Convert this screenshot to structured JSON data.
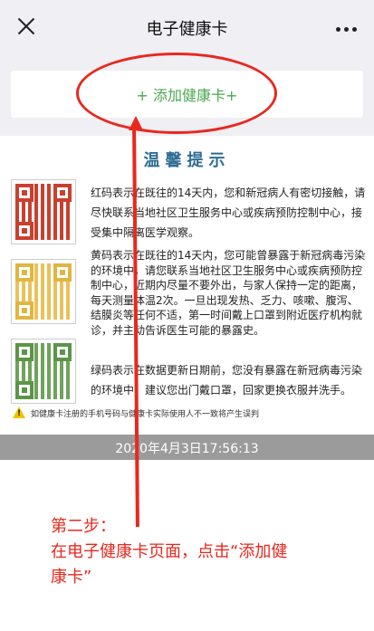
{
  "header": {
    "title": "电子健康卡",
    "close_icon": "close-icon",
    "more_icon": "more-icon"
  },
  "add_card": {
    "label": "+ 添加健康卡+"
  },
  "tips": {
    "title": "温馨提示",
    "red": "红码表示在既往的14天内，您和新冠病人有密切接触，请尽快联系当地社区卫生服务中心或疾病预防控制中心，接受集中隔离医学观察。",
    "yellow": "黄码表示在既往的14天内，您可能曾暴露于新冠病毒污染的环境中，请您联系当地社区卫生服务中心或疾病预防控制中心，近期内尽量不要外出，与家人保持一定的距离，每天测量体温2次。一旦出现发热、乏力、咳嗽、腹泻、结膜炎等任何不适，第一时间戴上口罩到附近医疗机构就诊，并主动告诉医生可能的暴露史。",
    "green": "绿码表示在数据更新日期前，您没有暴露在新冠病毒污染的环境中，建议您出门戴口罩，回家更换衣服并洗手。",
    "warning": "如健康卡注册的手机号码与健康卡实际使用人不一致将产生误判"
  },
  "timestamp": "2020年4月3日17:56:13",
  "annotation": {
    "line1": "第二步：",
    "line2": "在电子健康卡页面，点击“添加健",
    "line3": "康卡”"
  },
  "colors": {
    "accent_green": "#4aa84e",
    "annotation_red": "#e8281e",
    "tips_blue": "#2f6d93"
  }
}
